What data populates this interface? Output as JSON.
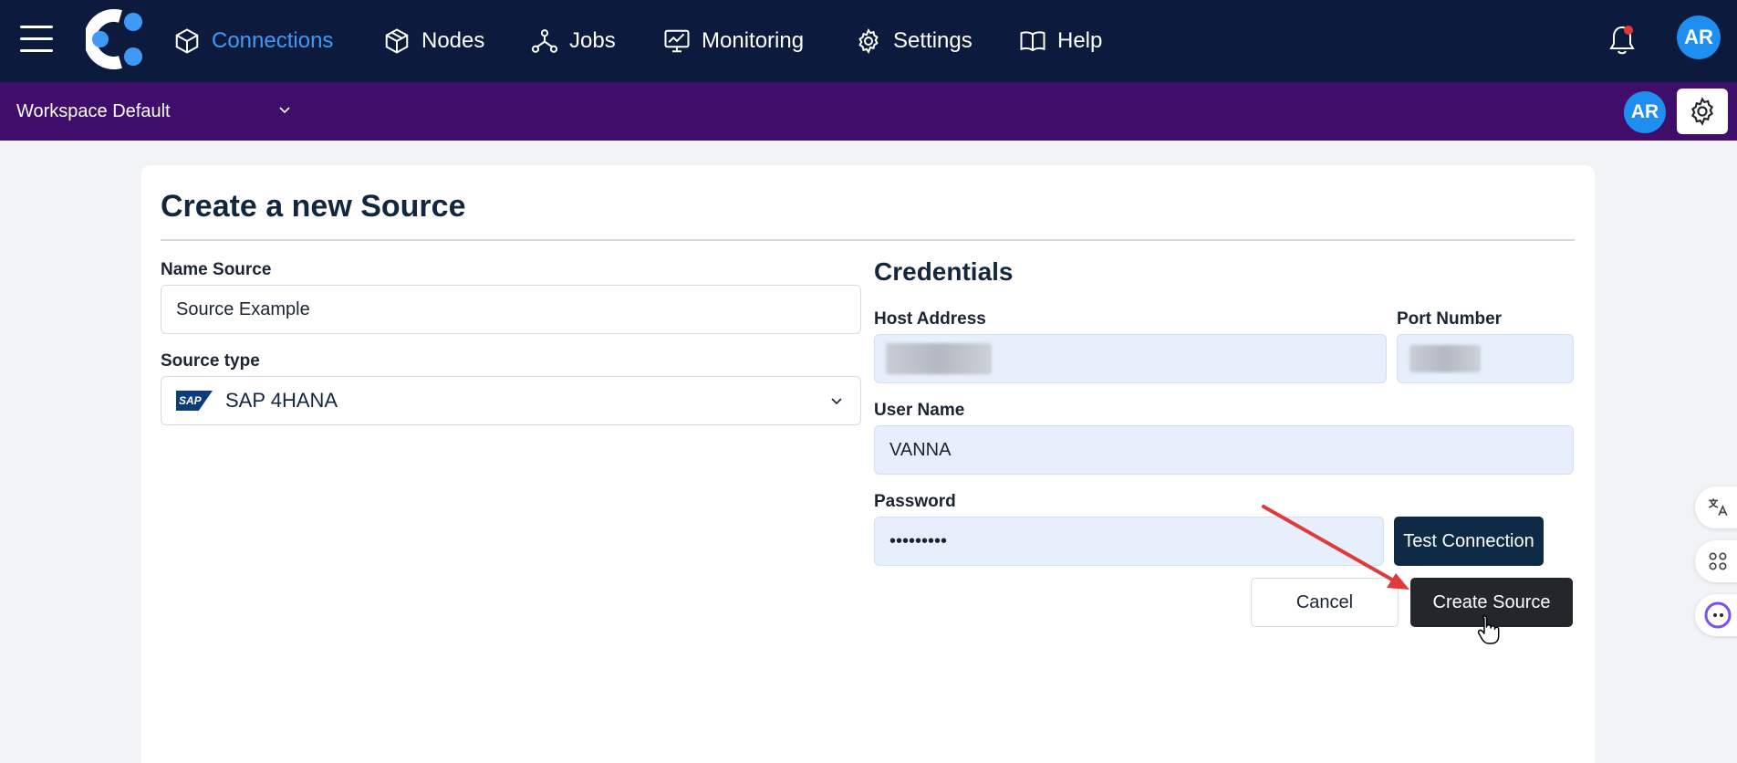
{
  "nav": {
    "items": [
      {
        "label": "Connections",
        "icon": "cube-icon",
        "active": true
      },
      {
        "label": "Nodes",
        "icon": "boxes-icon"
      },
      {
        "label": "Jobs",
        "icon": "network-icon"
      },
      {
        "label": "Monitoring",
        "icon": "monitor-chart-icon"
      },
      {
        "label": "Settings",
        "icon": "gear-icon"
      },
      {
        "label": "Help",
        "icon": "book-icon"
      }
    ],
    "avatar": "AR"
  },
  "workspace": {
    "selected": "Workspace Default",
    "avatar": "AR"
  },
  "form": {
    "title": "Create a new Source",
    "name_label": "Name Source",
    "name_value": "Source Example",
    "source_type_label": "Source type",
    "source_type_logo": "SAP",
    "source_type_value": "SAP 4HANA",
    "credentials_title": "Credentials",
    "host_label": "Host Address",
    "port_label": "Port Number",
    "user_label": "User Name",
    "user_value": "VANNA",
    "password_label": "Password",
    "password_value": "•••••••••",
    "test_button": "Test Connection",
    "cancel_button": "Cancel",
    "create_button": "Create Source"
  },
  "colors": {
    "topbar": "#0c1b3d",
    "workspace_bar": "#3f0e6a",
    "accent": "#3e9af5",
    "avatar": "#1e8ef0",
    "annotation_arrow": "#e03a3a"
  }
}
